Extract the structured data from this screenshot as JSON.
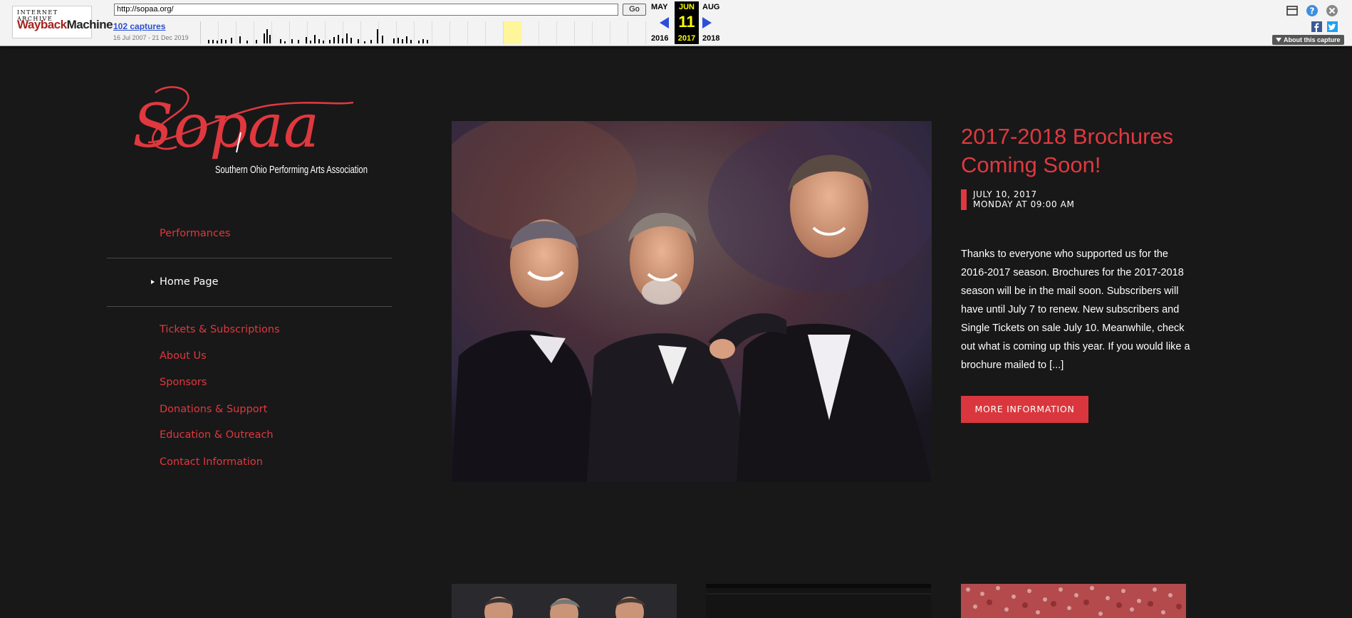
{
  "wayback": {
    "logo_top": "INTERNET ARCHIVE",
    "logo_main_a": "Wayback",
    "logo_main_b": "Machine",
    "url": "http://sopaa.org/",
    "go_label": "Go",
    "captures": "102 captures",
    "date_range": "16 Jul 2007 - 21 Dec 2019",
    "prev_month": "MAY",
    "cur_month": "JUN",
    "next_month": "AUG",
    "cur_day": "11",
    "prev_year": "2016",
    "cur_year": "2017",
    "next_year": "2018",
    "about_label": "About this capture",
    "icons": [
      "window-icon",
      "help-icon",
      "close-icon",
      "facebook-icon",
      "twitter-icon"
    ]
  },
  "site": {
    "logo_script": "Sopaa",
    "logo_tagline": "Southern Ohio Performing Arts Association",
    "accent_color": "#e0383f",
    "background_color": "#181818"
  },
  "menu": {
    "items": [
      {
        "label": "Performances"
      },
      {
        "label": "Home Page"
      },
      {
        "label": "Tickets & Subscriptions"
      },
      {
        "label": "About Us"
      },
      {
        "label": "Sponsors"
      },
      {
        "label": "Donations & Support"
      },
      {
        "label": "Education & Outreach"
      },
      {
        "label": "Contact Information"
      }
    ]
  },
  "post": {
    "title": "2017-2018 Brochures Coming Soon!",
    "date": "JULY 10, 2017",
    "time": "MONDAY AT 09:00 AM",
    "excerpt": "Thanks to everyone who supported us for the 2016-2017 season. Brochures for the 2017-2018 season will be in the mail soon. Subscribers will have until July 7 to renew. New subscribers and Single Tickets on sale July 10. Meanwhile, check out what is coming up this year. If you would like a brochure mailed to [...]",
    "button_label": "MORE INFORMATION"
  }
}
